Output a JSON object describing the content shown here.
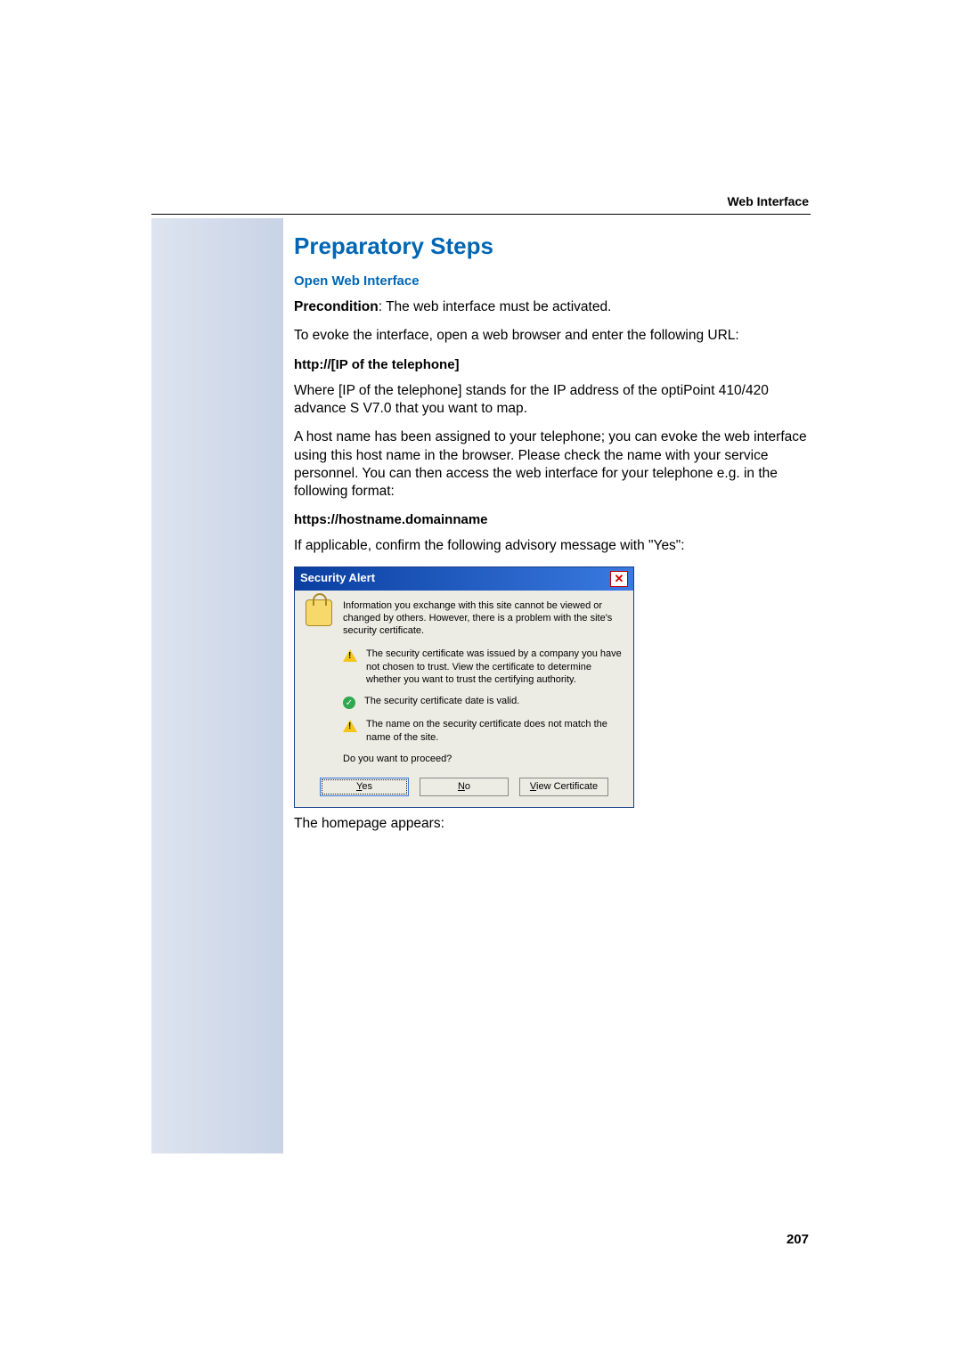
{
  "header": {
    "section": "Web Interface"
  },
  "title": "Preparatory Steps",
  "subhead1": "Open Web Interface",
  "precondition_label": "Precondition",
  "precondition_text": ": The web interface must be activated.",
  "para_evoke": "To evoke the interface, open a web browser and enter the following URL:",
  "url1": "http://[IP of the telephone]",
  "para_ip": "Where [IP of the telephone] stands for the IP address of the optiPoint 410/420 advance S V7.0 that you want to map.",
  "para_hostname": "A host name has been assigned to your telephone; you can evoke the web interface using this host name in the browser. Please check the name with your service personnel. You can then access the web interface for your telephone e.g. in the following format:",
  "url2": "https://hostname.domainname",
  "para_confirm": "If applicable, confirm the following advisory message with \"Yes\":",
  "dialog": {
    "title": "Security Alert",
    "intro": "Information you exchange with this site cannot be viewed or changed by others. However, there is a problem with the site's security certificate.",
    "item1": "The security certificate was issued by a company you have not chosen to trust. View the certificate to determine whether you want to trust the certifying authority.",
    "item2": "The security certificate date is valid.",
    "item3": "The name on the security certificate does not match the name of the site.",
    "question": "Do you want to proceed?",
    "btn_yes": "Yes",
    "btn_no": "No",
    "btn_view": "View Certificate"
  },
  "para_homepage": "The homepage appears:",
  "page_number": "207"
}
